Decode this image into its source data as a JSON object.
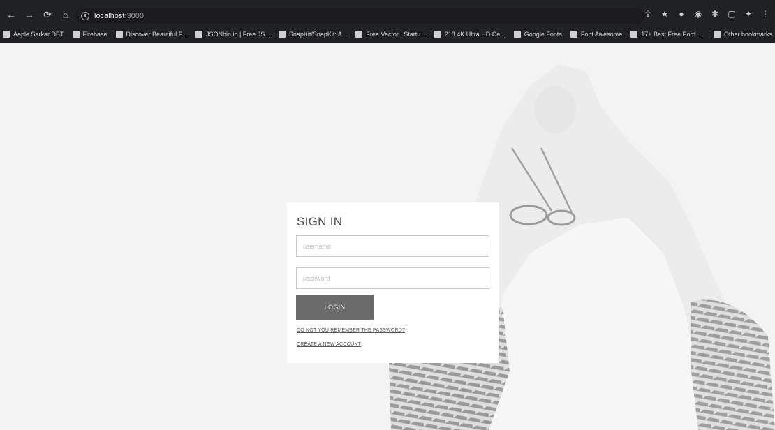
{
  "browser": {
    "nav": {
      "back": "←",
      "forward": "→",
      "reload": "⟳",
      "home": "⌂"
    },
    "url_host": "localhost",
    "url_port": ":3000",
    "bookmarks": [
      "Aaple Sarkar DBT",
      "Firebase",
      "Discover Beautiful P...",
      "JSONbin.io | Free JS...",
      "SnapKit/SnapKit: A...",
      "Free Vector | Startu...",
      "218 4K Ultra HD Ca...",
      "Google Fonts",
      "Font Awesome",
      "17+ Best Free Portf..."
    ],
    "other_bookmarks": "Other bookmarks"
  },
  "signin": {
    "title": "SIGN IN",
    "username_placeholder": "username",
    "password_placeholder": "password",
    "login_label": "LOGIN",
    "forgot_link": "DO NOT YOU REMEMBER THE PASSWORD?",
    "create_link": "CREATE A NEW ACCOUNT"
  },
  "colors": {
    "chrome": "#202124",
    "button": "#6b6b6b",
    "page_bg": "#f3f3f3"
  }
}
